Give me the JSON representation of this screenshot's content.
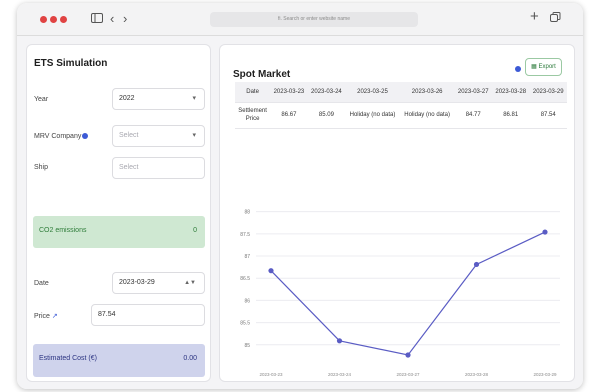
{
  "browser": {
    "url": "fi. Search or enter website name",
    "icons": {
      "sidebar": "sidebar-icon",
      "back": "chevron-left-icon",
      "forward": "chevron-right-icon",
      "new_tab": "plus-icon",
      "tabs": "tabs-icon"
    }
  },
  "left_panel": {
    "title": "ETS Simulation",
    "year": {
      "label": "Year",
      "value": "2022"
    },
    "mrv_company": {
      "label": "MRV Company",
      "placeholder": "Select"
    },
    "ship": {
      "label": "Ship",
      "placeholder": "Select"
    },
    "co2": {
      "label": "CO2 emissions",
      "value": "0"
    },
    "date": {
      "label": "Date",
      "value": "2023-03-29"
    },
    "price": {
      "label": "Price",
      "value": "87.54"
    },
    "estimated_cost": {
      "label": "Estimated Cost (€)",
      "value": "0.00"
    }
  },
  "spot_market": {
    "title": "Spot Market",
    "export_label": "Export",
    "table": {
      "header": [
        "Date",
        "2023-03-23",
        "2023-03-24",
        "2023-03-25",
        "2023-03-26",
        "2023-03-27",
        "2023-03-28",
        "2023-03-29"
      ],
      "row_label_1": "Settlement",
      "row_label_2": "Price",
      "row": [
        "86.67",
        "85.09",
        "Holiday (no data)",
        "Holiday (no data)",
        "84.77",
        "86.81",
        "87.54"
      ]
    }
  },
  "chart_data": {
    "type": "line",
    "x": [
      "2023-03-23",
      "2023-03-24",
      "2023-03-27",
      "2023-03-28",
      "2023-03-29"
    ],
    "x_tick_labels": [
      "2023-03-23",
      "2023-03-24",
      "2023-03-27",
      "2023-03-28",
      "2023-03-29"
    ],
    "y_ticks": [
      85,
      85.5,
      86,
      86.5,
      87,
      87.5,
      88
    ],
    "ylim": [
      84.5,
      88.6
    ],
    "series": [
      {
        "values": [
          86.67,
          85.09,
          84.77,
          86.81,
          87.54
        ]
      }
    ],
    "line_color": "#5a5cc4",
    "grid": true
  },
  "colors": {
    "close_dot": "#e04343",
    "co2_bg": "#cfe8d2",
    "cost_bg": "#cfd3ec",
    "accent": "#3c5ad6",
    "export_green": "#2a7a3a"
  }
}
